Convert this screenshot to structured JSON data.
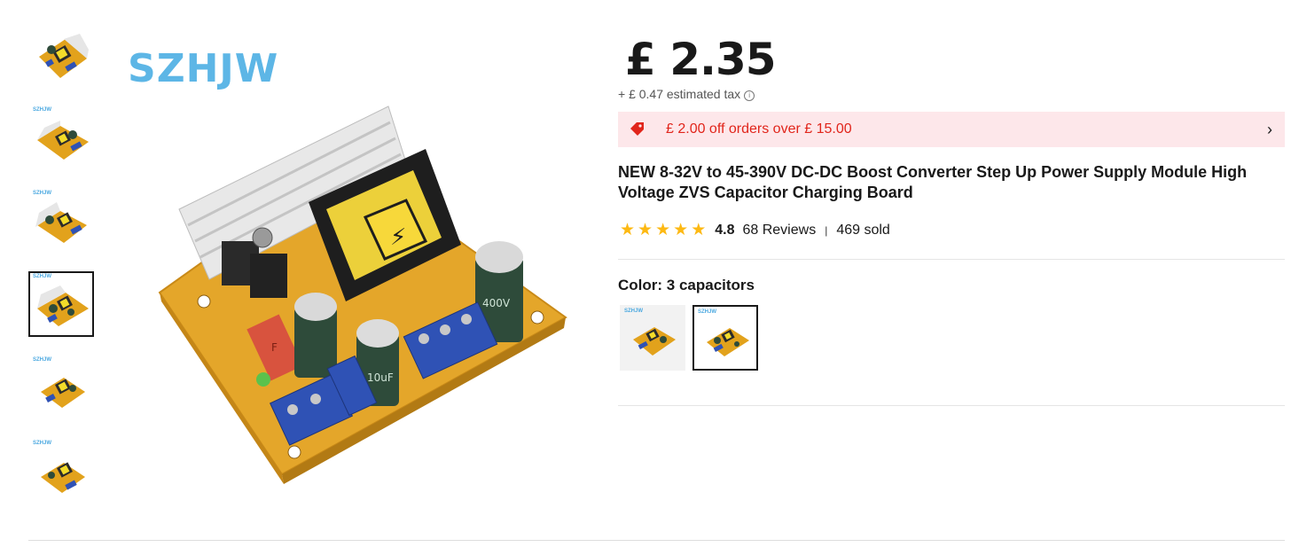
{
  "brand": "SZHJW",
  "thumbnails": [
    {
      "watermark": "",
      "selected": false
    },
    {
      "watermark": "SZHJW",
      "selected": false
    },
    {
      "watermark": "SZHJW",
      "selected": false
    },
    {
      "watermark": "SZHJW",
      "selected": true
    },
    {
      "watermark": "SZHJW",
      "selected": false
    },
    {
      "watermark": "SZHJW",
      "selected": false
    }
  ],
  "price": {
    "main": "£ 2.35",
    "tax": "+ £ 0.47 estimated tax"
  },
  "promo": {
    "text": "£ 2.00 off orders over  £ 15.00",
    "icon": "coupon-tag-icon",
    "color": "#e1251b",
    "background": "#fde7ea"
  },
  "product": {
    "title": "NEW 8-32V to 45-390V DC-DC Boost Converter Step Up Power Supply Module High Voltage ZVS Capacitor Charging Board"
  },
  "rating": {
    "stars": 5,
    "score": "4.8",
    "reviews": "68 Reviews",
    "separator": "|",
    "sold": "469 sold",
    "star_color": "#fdb913"
  },
  "variant": {
    "label": "Color: 3 capacitors",
    "options": [
      {
        "watermark": "SZHJW",
        "selected": false
      },
      {
        "watermark": "SZHJW",
        "selected": true
      }
    ]
  },
  "product_image": {
    "warning_symbol": "⚡",
    "cap_labels": [
      "10uF",
      "10uF",
      "400V"
    ],
    "fuse_label": "F"
  }
}
